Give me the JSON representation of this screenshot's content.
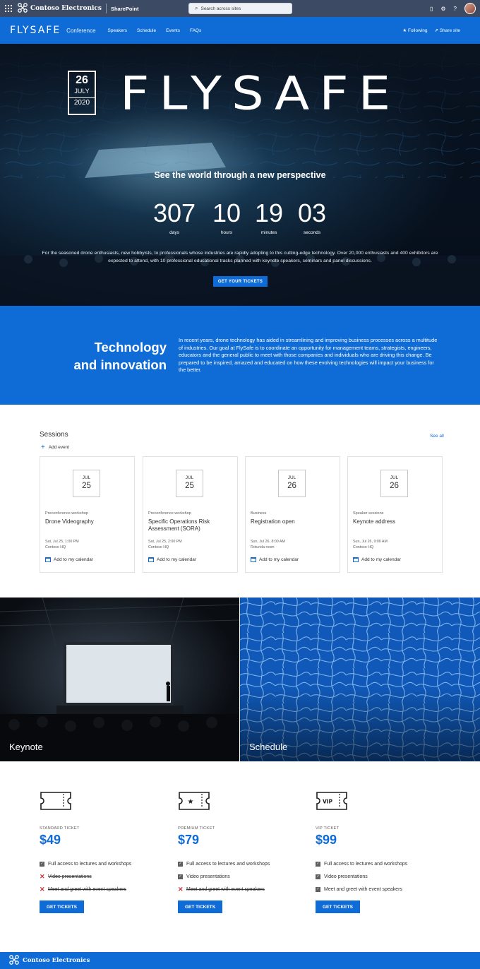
{
  "suite": {
    "org": "Contoso Electronics",
    "app": "SharePoint",
    "search_placeholder": "Search across sites"
  },
  "site": {
    "logo": "FLYSAFE",
    "name": "Conference",
    "nav": [
      "Speakers",
      "Schedule",
      "Events",
      "FAQs"
    ],
    "following": "Following",
    "share": "Share site"
  },
  "hero": {
    "day": "26",
    "month": "JULY",
    "year": "2020",
    "title": "FLYSAFE",
    "tagline": "See the world through a new perspective",
    "countdown": [
      {
        "value": "307",
        "label": "days"
      },
      {
        "value": "10",
        "label": "hours"
      },
      {
        "value": "19",
        "label": "minutes"
      },
      {
        "value": "03",
        "label": "seconds"
      }
    ],
    "description": "For the seasoned drone enthusiasts, new hobbyists, to professionals whose industries are rapidly adopting to this cutting-edge technology. Over 20,000 enthusiasts and 400 exhibitors are expected to attend, with 10 professional educational tracks planned with keynote speakers, seminars and panel discussions.",
    "button": "GET YOUR TICKETS"
  },
  "tech": {
    "heading1": "Technology",
    "heading2": "and innovation",
    "body": "In recent years, drone technology has aided in streamlining and improving business processes across a multitude of industries. Our goal at FlySafe is to coordinate an opportunity for management teams, strategists, engineers, educators and the general public to meet with those companies and individuals who are driving this change. Be prepared to be inspired, amazed and educated on how these evolving technologies will impact your business for the better."
  },
  "sessions": {
    "title": "Sessions",
    "see_all": "See all",
    "add_event": "Add event",
    "calendar_label": "Add to my calendar",
    "items": [
      {
        "month": "JUL",
        "day": "25",
        "category": "Preconference workshop",
        "title": "Drone Videography",
        "when": "Sat, Jul 25, 1:00 PM",
        "where": "Contoso HQ"
      },
      {
        "month": "JUL",
        "day": "25",
        "category": "Preconference workshop",
        "title": "Specific Operations Risk Assessment (SORA)",
        "when": "Sat, Jul 25, 2:00 PM",
        "where": "Contoso HQ"
      },
      {
        "month": "JUL",
        "day": "26",
        "category": "Business",
        "title": "Registration open",
        "when": "Sun, Jul 26, 8:00 AM",
        "where": "Rotunda room"
      },
      {
        "month": "JUL",
        "day": "26",
        "category": "Speaker sessions",
        "title": "Keynote address",
        "when": "Sun, Jul 26, 9:00 AM",
        "where": "Contoso HQ"
      }
    ]
  },
  "tiles": {
    "keynote": "Keynote",
    "schedule": "Schedule"
  },
  "tickets": [
    {
      "type": "STANDARD TICKET",
      "price": "$49",
      "badge": "",
      "button": "GET TICKETS",
      "features": [
        {
          "text": "Full access to lectures and workshops",
          "included": true
        },
        {
          "text": "Video presentations",
          "included": false
        },
        {
          "text": "Meet and greet with event speakers",
          "included": false
        }
      ]
    },
    {
      "type": "PREMIUM TICKET",
      "price": "$79",
      "badge": "★",
      "button": "GET TICKETS",
      "features": [
        {
          "text": "Full access to lectures and workshops",
          "included": true
        },
        {
          "text": "Video presentations",
          "included": true
        },
        {
          "text": "Meet and greet with event speakers",
          "included": false
        }
      ]
    },
    {
      "type": "VIP TICKET",
      "price": "$99",
      "badge": "VIP",
      "button": "GET TICKETS",
      "features": [
        {
          "text": "Full access to lectures and workshops",
          "included": true
        },
        {
          "text": "Video presentations",
          "included": true
        },
        {
          "text": "Meet and greet with event speakers",
          "included": true
        }
      ]
    }
  ],
  "footer": {
    "org": "Contoso Electronics"
  },
  "colors": {
    "accent": "#0f6cd6",
    "suite_bar": "#3c4b63",
    "strike": "#d13438"
  }
}
